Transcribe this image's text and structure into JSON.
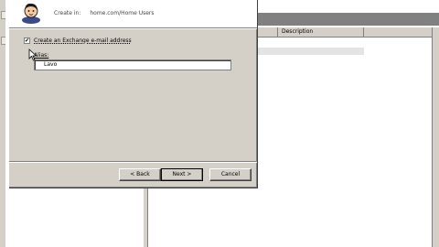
{
  "dialog": {
    "create_in_label": "Create in:",
    "create_in_path": "home.com/Home Users",
    "exchange_checkbox_label": "Create an Exchange e-mail address",
    "exchange_checked": true,
    "alias_label": "Alias:",
    "alias_value": "Lavo",
    "buttons": {
      "back": "< Back",
      "next": "Next >",
      "cancel": "Cancel"
    },
    "checkmark_glyph": "✔"
  },
  "background": {
    "columns": [
      "",
      "Description"
    ]
  },
  "colors": {
    "dialog_face": "#d4d0c8",
    "title_bar_gray": "#808080"
  }
}
